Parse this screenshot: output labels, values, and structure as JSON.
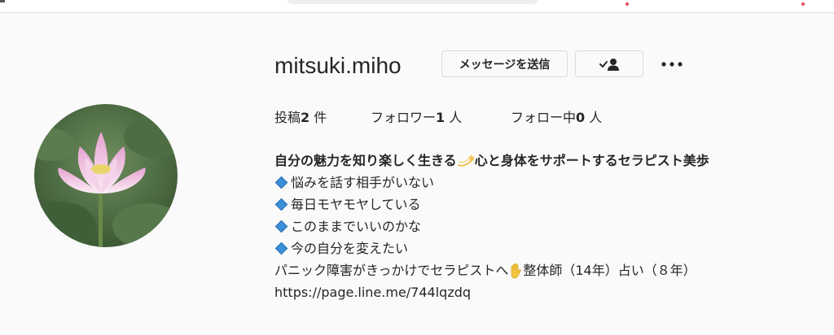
{
  "profile": {
    "username": "mitsuki.miho",
    "message_button": "メッセージを送信",
    "stats": {
      "posts_label": "投稿",
      "posts_count": "2",
      "posts_unit": " 件",
      "followers_label": "フォロワー",
      "followers_count": "1",
      "followers_unit": " 人",
      "following_label": "フォロー中",
      "following_count": "0",
      "following_unit": " 人"
    },
    "bio": {
      "name_part1": "自分の魅力を知り楽しく生きる",
      "name_part2": "心と身体をサポートするセラピスト美歩",
      "bullets": [
        "悩みを話す相手がいない",
        "毎日モヤモヤしている",
        "このままでいいのかな",
        "今の自分を変えたい"
      ],
      "line_part1": "パニック障害がきっかけでセラピストへ",
      "line_part2": "整体師（14年）占い（８年）",
      "link": "https://page.line.me/744lqzdq"
    }
  },
  "icons": {
    "follow_status": "person-check-icon",
    "more": "more-horizontal-icon",
    "bullet": "blue-diamond-icon",
    "sparkle": "dizzy-star-icon",
    "hand": "raised-hand-icon"
  },
  "colors": {
    "background": "#fafafa",
    "text": "#262626",
    "border": "#dbdbdb",
    "bullet": "#3b8fd9"
  }
}
